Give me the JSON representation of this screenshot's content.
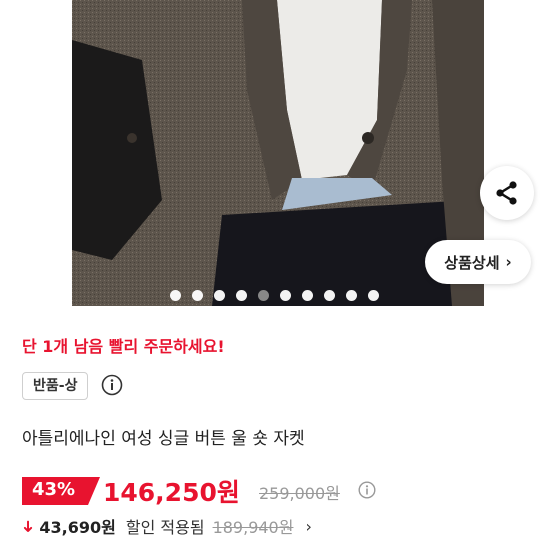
{
  "product_image": {
    "detail_button_label": "상품상세",
    "carousel": {
      "total": 10,
      "active_index": 4
    }
  },
  "stock_notice": "단 1개 남음 빨리 주문하세요!",
  "condition_badge": "반품-상",
  "title": "아틀리에나인 여성 싱글 버튼 울 숏 자켓",
  "pricing": {
    "discount": "43%",
    "price": "146,250원",
    "original_price": "259,000원",
    "extra_discount": "43,690원",
    "extra_discount_label": "할인 적용됨",
    "final_price": "189,940원"
  },
  "colors": {
    "accent_red": "#e8132f"
  }
}
